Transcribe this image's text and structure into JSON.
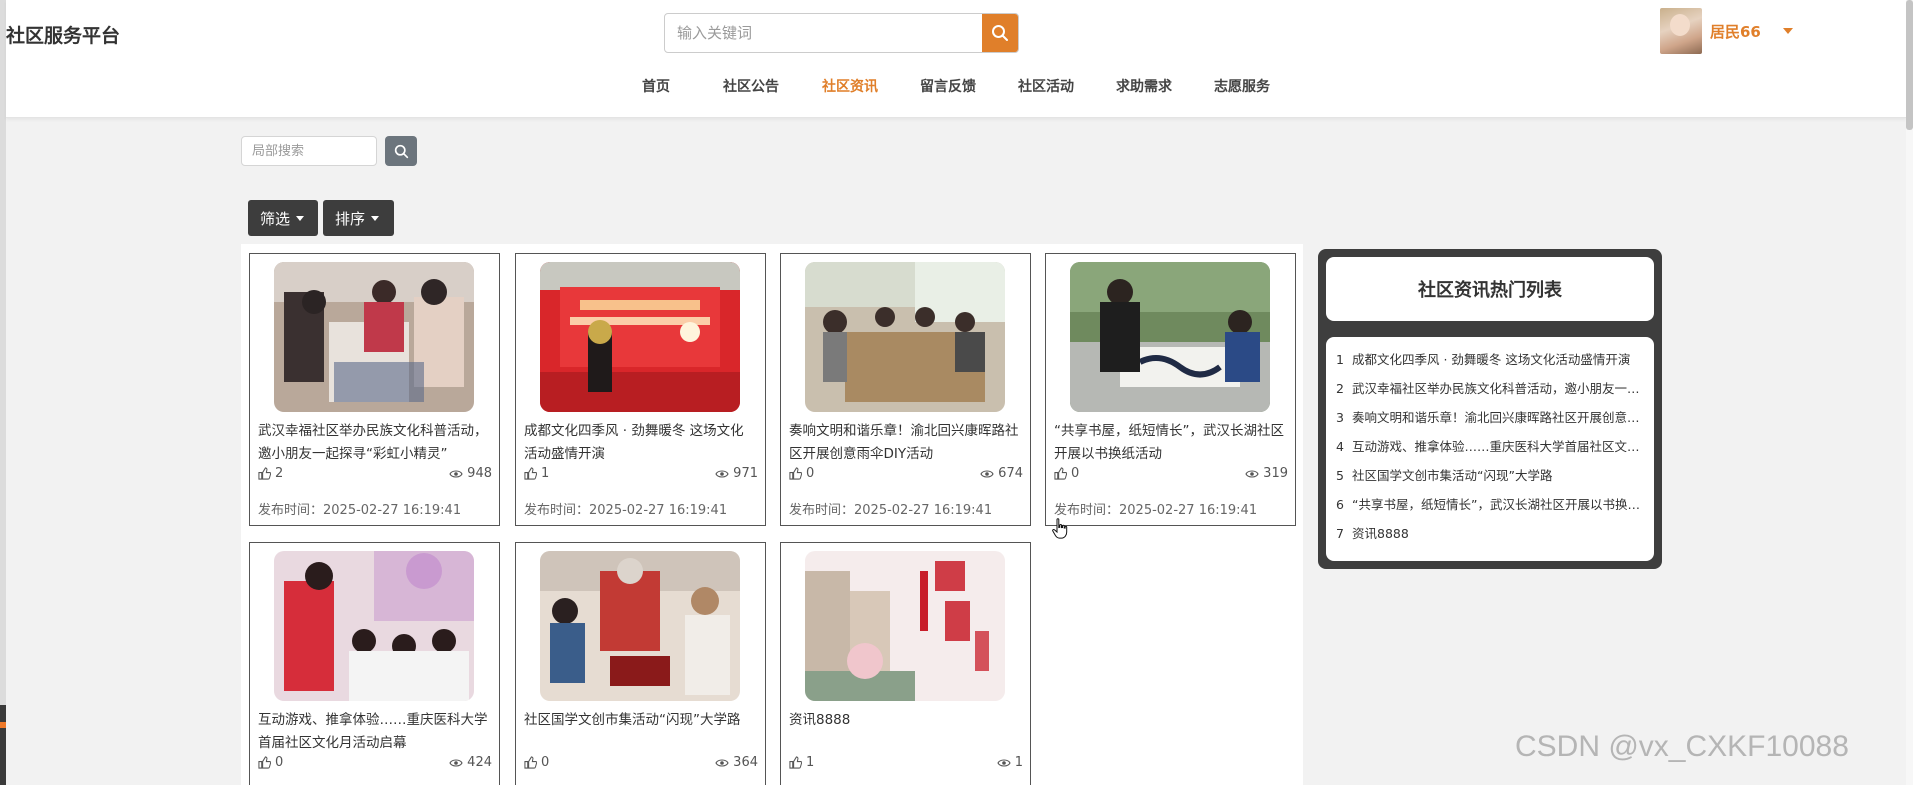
{
  "header": {
    "brand": "社区服务平台",
    "search_placeholder": "输入关键词",
    "username": "居民66"
  },
  "nav": [
    {
      "label": "首页",
      "active": false
    },
    {
      "label": "社区公告",
      "active": false
    },
    {
      "label": "社区资讯",
      "active": true
    },
    {
      "label": "留言反馈",
      "active": false
    },
    {
      "label": "社区活动",
      "active": false
    },
    {
      "label": "求助需求",
      "active": false
    },
    {
      "label": "志愿服务",
      "active": false
    }
  ],
  "local_search": {
    "placeholder": "局部搜索"
  },
  "filters": {
    "filter_label": "筛选",
    "sort_label": "排序"
  },
  "cards": [
    {
      "title": "武汉幸福社区举办民族文化科普活动，邀小朋友一起探寻“彩虹小精灵”",
      "likes": "2",
      "views": "948",
      "time_label": "发布时间：",
      "time": "2025-02-27 16:19:41",
      "image": "children-craft-activity"
    },
    {
      "title": "成都文化四季风 · 劲舞暖冬 这场文化活动盛情开演",
      "likes": "1",
      "views": "971",
      "time_label": "发布时间：",
      "time": "2025-02-27 16:19:41",
      "image": "stage-performance"
    },
    {
      "title": "奏响文明和谐乐章！渝北回兴康晖路社区开展创意雨伞DIY活动",
      "likes": "0",
      "views": "674",
      "time_label": "发布时间：",
      "time": "2025-02-27 16:19:41",
      "image": "long-table-workshop"
    },
    {
      "title": "“共享书屋，纸短情长”，武汉长湖社区开展以书换纸活动",
      "likes": "0",
      "views": "319",
      "time_label": "发布时间：",
      "time": "2025-02-27 16:19:41",
      "image": "calligraphy"
    },
    {
      "title": "互动游戏、推拿体验……重庆医科大学首届社区文化月活动启幕",
      "likes": "0",
      "views": "424",
      "time_label": "",
      "time": "",
      "image": "kids-interactive-game"
    },
    {
      "title": "社区国学文创市集活动“闪现”大学路",
      "likes": "0",
      "views": "364",
      "time_label": "",
      "time": "",
      "image": "kids-crafts-market"
    },
    {
      "title": "资讯8888",
      "likes": "1",
      "views": "1",
      "time_label": "",
      "time": "",
      "image": "residential-poster"
    }
  ],
  "hot_list": {
    "title": "社区资讯热门列表",
    "items": [
      {
        "num": "1",
        "text": "成都文化四季风 · 劲舞暖冬 这场文化活动盛情开演"
      },
      {
        "num": "2",
        "text": "武汉幸福社区举办民族文化科普活动，邀小朋友一起探寻“彩虹小精灵”"
      },
      {
        "num": "3",
        "text": "奏响文明和谐乐章！渝北回兴康晖路社区开展创意雨伞DIY活动"
      },
      {
        "num": "4",
        "text": "互动游戏、推拿体验……重庆医科大学首届社区文化月活动启幕"
      },
      {
        "num": "5",
        "text": "社区国学文创市集活动“闪现”大学路"
      },
      {
        "num": "6",
        "text": "“共享书屋，纸短情长”，武汉长湖社区开展以书换纸活动"
      },
      {
        "num": "7",
        "text": "资讯8888"
      }
    ]
  },
  "watermark": "CSDN @vx_CXKF10088",
  "colors": {
    "accent": "#e07f2a",
    "dark_button": "#3d3d3d",
    "panel_dark": "#3e3e3e"
  }
}
